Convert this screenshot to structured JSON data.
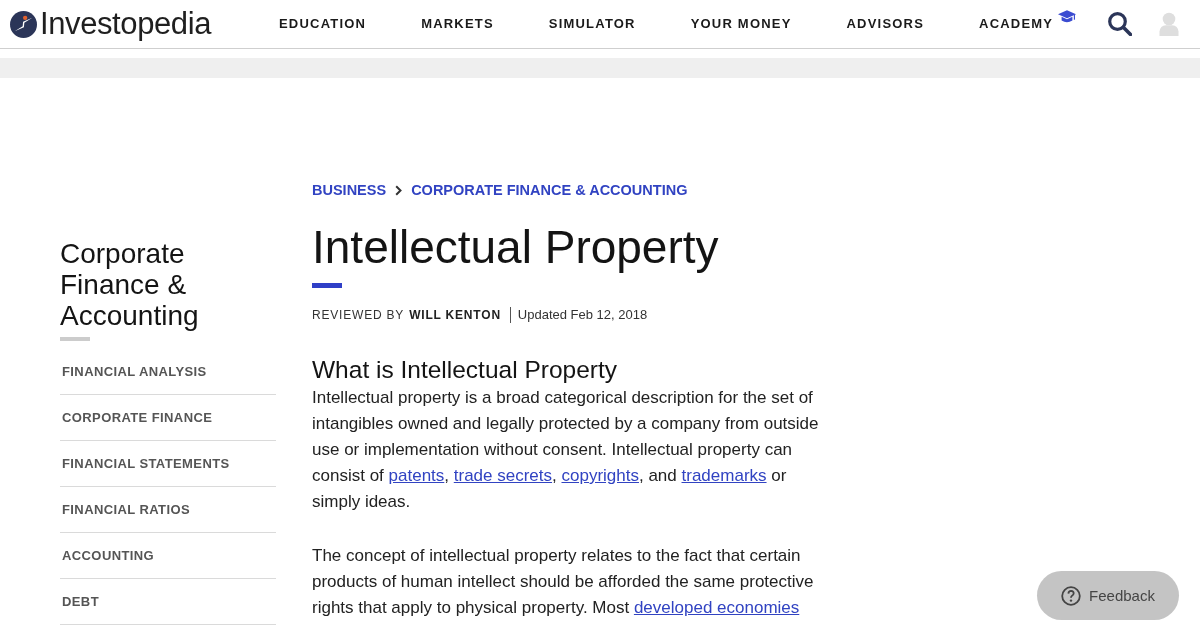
{
  "header": {
    "logo": {
      "wordmark": "Investopedia"
    },
    "nav": [
      {
        "label": "EDUCATION",
        "has_icon": false
      },
      {
        "label": "MARKETS",
        "has_icon": false
      },
      {
        "label": "SIMULATOR",
        "has_icon": false
      },
      {
        "label": "YOUR MONEY",
        "has_icon": false
      },
      {
        "label": "ADVISORS",
        "has_icon": false
      },
      {
        "label": "ACADEMY",
        "has_icon": true
      }
    ]
  },
  "breadcrumbs": [
    "BUSINESS",
    "CORPORATE FINANCE & ACCOUNTING"
  ],
  "sidebar": {
    "title": "Corporate Finance & Accounting",
    "items": [
      "FINANCIAL ANALYSIS",
      "CORPORATE FINANCE",
      "FINANCIAL STATEMENTS",
      "FINANCIAL RATIOS",
      "ACCOUNTING",
      "DEBT"
    ]
  },
  "article": {
    "title": "Intellectual Property",
    "byline": {
      "label": "REVIEWED BY",
      "reviewer": "WILL KENTON",
      "updated": "Updated Feb 12, 2018"
    },
    "sections": [
      {
        "heading": "What is Intellectual Property",
        "paragraphs": [
          [
            {
              "kind": "text",
              "text": "Intellectual property is a broad categorical description for the set of intangibles owned and legally protected by a company from outside use or implementation without consent. Intellectual property can consist of "
            },
            {
              "kind": "link",
              "text": "patents"
            },
            {
              "kind": "text",
              "text": ", "
            },
            {
              "kind": "link",
              "text": "trade secrets"
            },
            {
              "kind": "text",
              "text": ", "
            },
            {
              "kind": "link",
              "text": "copyrights"
            },
            {
              "kind": "text",
              "text": ", and "
            },
            {
              "kind": "link",
              "text": "trademarks"
            },
            {
              "kind": "text",
              "text": " or simply ideas."
            }
          ],
          [
            {
              "kind": "text",
              "text": "The concept of intellectual property relates to the fact that certain products of human intellect should be afforded the same protective rights that apply to physical property. Most "
            },
            {
              "kind": "link",
              "text": "developed economies"
            }
          ]
        ]
      }
    ]
  },
  "feedback_button": {
    "label": "Feedback"
  }
}
